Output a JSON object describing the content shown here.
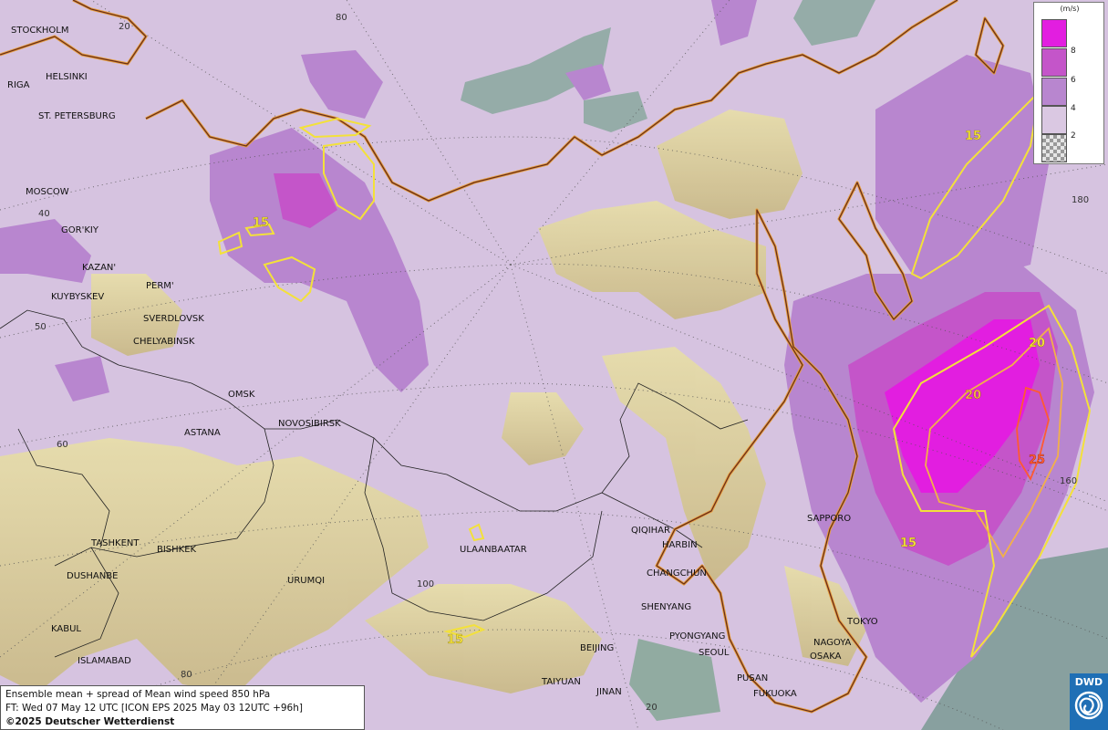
{
  "legend": {
    "unit": "(m/s)",
    "items": [
      {
        "label": "8",
        "color": "#e21ee0"
      },
      {
        "label": "6",
        "color": "#c455c9"
      },
      {
        "label": "4",
        "color": "#b886cf"
      },
      {
        "label": "2",
        "color": "#dac8e2"
      }
    ]
  },
  "info": {
    "line1": "Ensemble mean + spread of Mean wind speed 850 hPa",
    "line2": "FT: Wed 07 May 12 UTC [ICON EPS 2025 May 03 12UTC +96h]",
    "line3": "©2025 Deutscher Wetterdienst"
  },
  "logo": {
    "text": "DWD"
  },
  "cities": {
    "stockholm": "STOCKHOLM",
    "helsinki": "HELSINKI",
    "riga": "RIGA",
    "st_petersburg": "ST. PETERSBURG",
    "moscow": "MOSCOW",
    "gorkiy": "GOR'KIY",
    "kazan": "KAZAN'",
    "perm": "PERM'",
    "kuybyskev": "KUYBYSKEV",
    "sverdlovsk": "SVERDLOVSK",
    "chelyabinsk": "CHELYABINSK",
    "omsk": "OMSK",
    "novosibirsk": "NOVOSIBIRSK",
    "astana": "ASTANA",
    "tashkent": "TASHKENT",
    "bishkek": "BISHKEK",
    "dushanbe": "DUSHANBE",
    "urumqi": "URUMQI",
    "kabul": "KABUL",
    "islamabad": "ISLAMABAD",
    "ulaanbaatar": "ULAANBAATAR",
    "qiqihar": "QIQIHAR",
    "harbin": "HARBIN",
    "changchun": "CHANGCHUN",
    "shenyang": "SHENYANG",
    "pyongyang": "PYONGYANG",
    "seoul": "SEOUL",
    "beijing": "BEIJING",
    "taiyuan": "TAIYUAN",
    "jinan": "JINAN",
    "pusan": "PUSAN",
    "fukuoka": "FUKUOKA",
    "osaka": "OSAKA",
    "nagoya": "NAGOYA",
    "tokyo": "TOKYO",
    "sapporo": "SAPPORO"
  },
  "grid_labels": {
    "lat40": "40",
    "lat50": "50",
    "lat60": "60",
    "lon20": "20",
    "lon80": "80",
    "lon100": "100",
    "lon80b": "80",
    "lon20b": "20",
    "lon160": "160",
    "lon180": "180"
  },
  "contour_labels": {
    "c15_ural": "15",
    "c15_pacific": "15",
    "c20_a": "20",
    "c20_b": "20",
    "c25": "25",
    "c15_japan": "15",
    "c15_mongolia": "15"
  }
}
